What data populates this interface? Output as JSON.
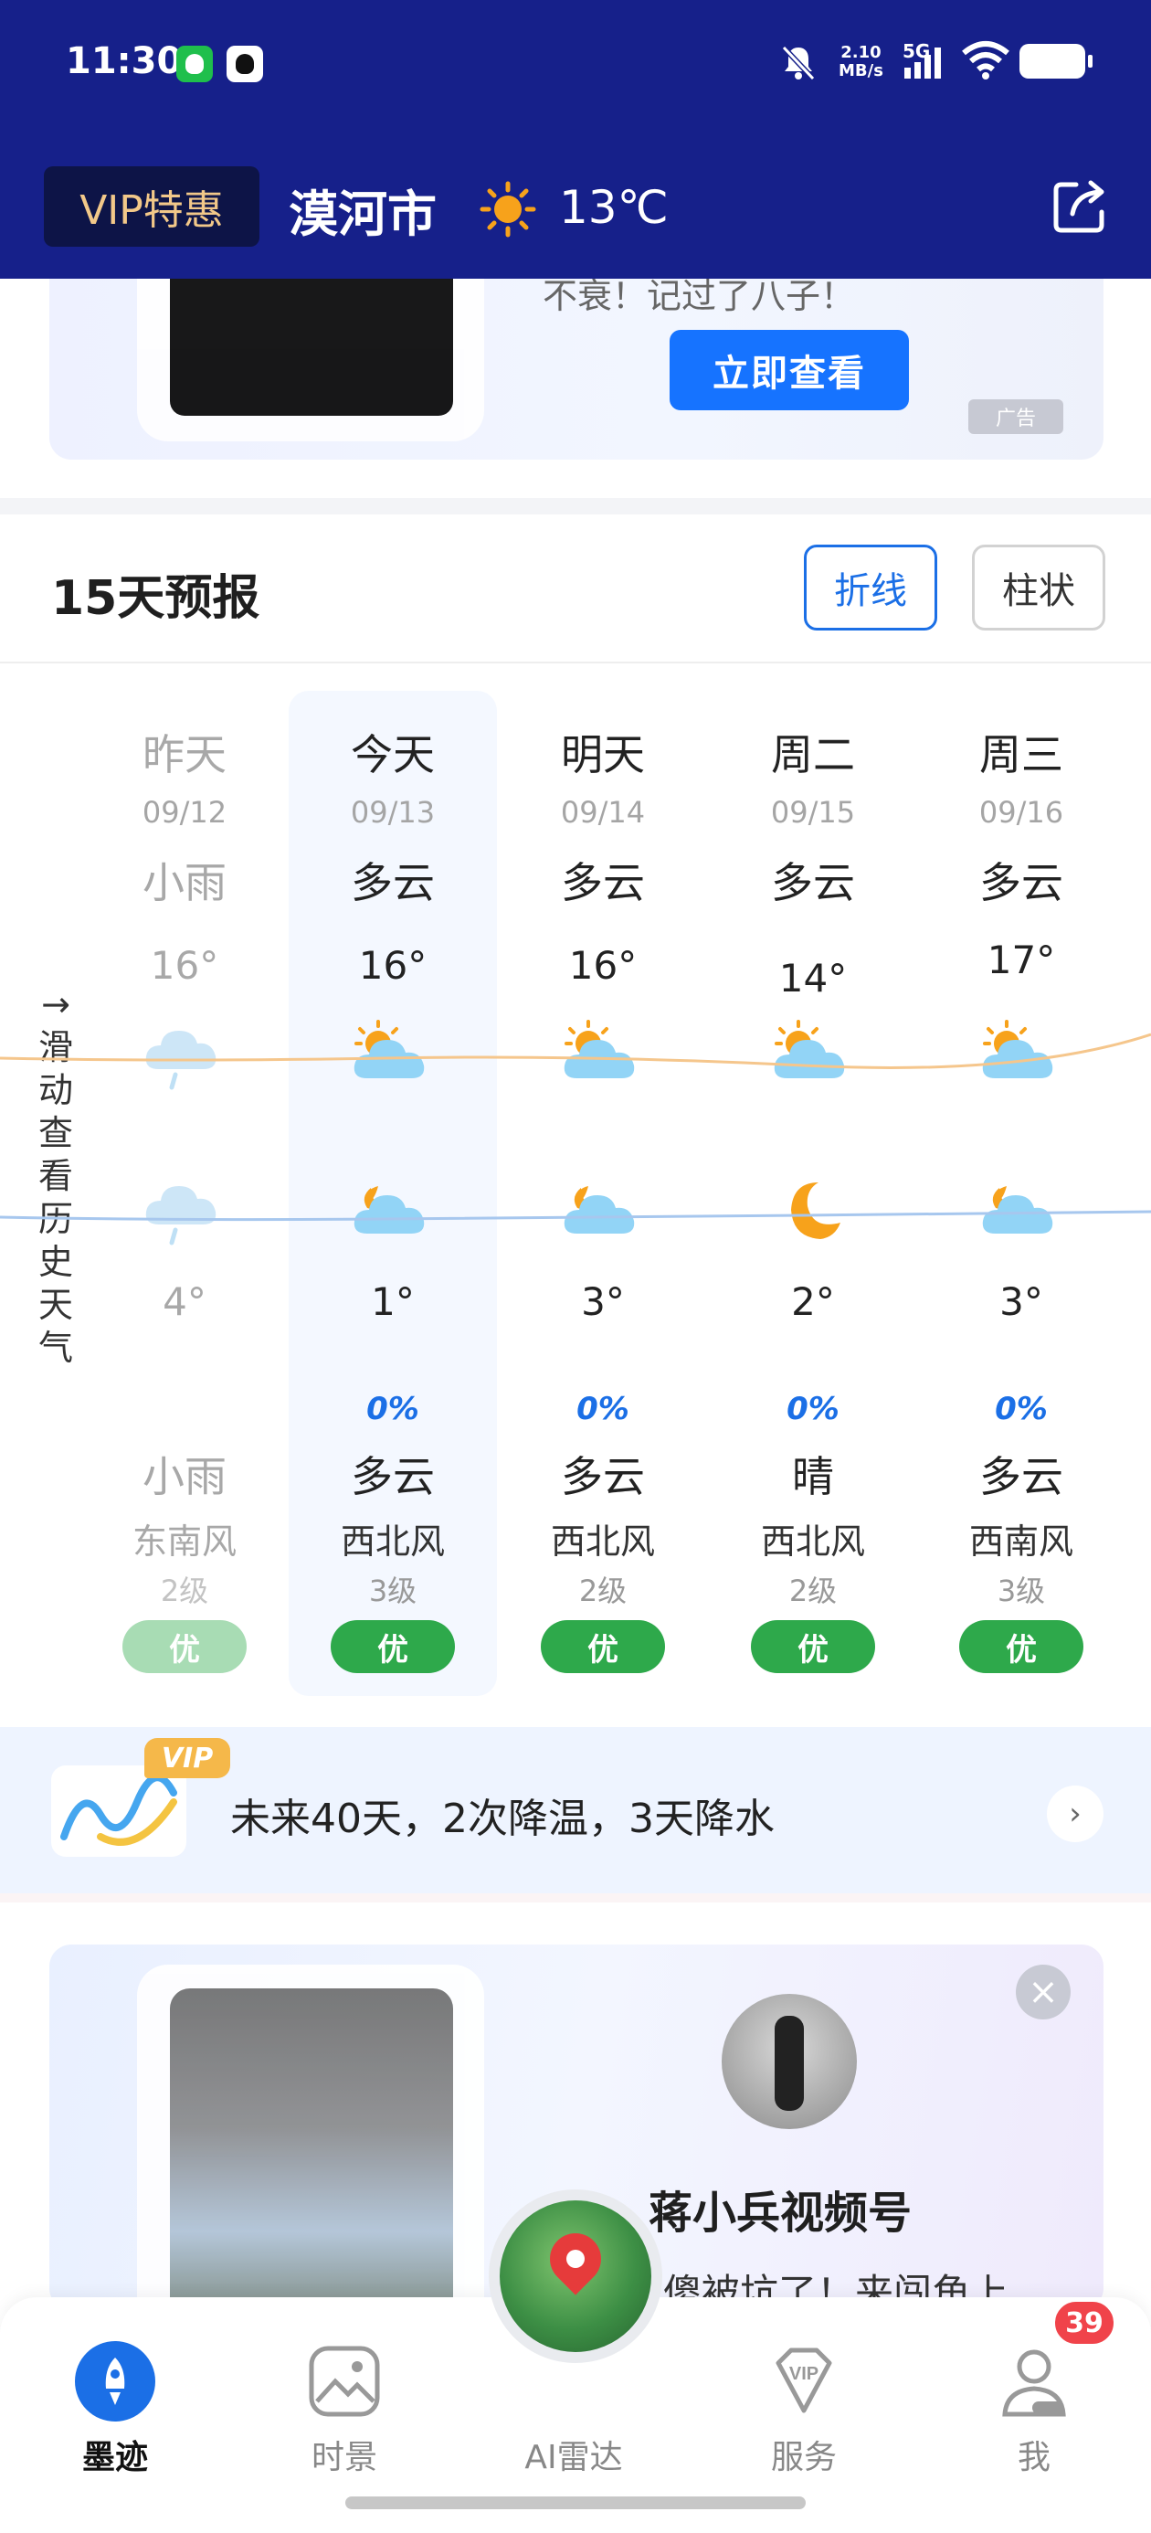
{
  "status_bar": {
    "time": "11:30",
    "net_speed_value": "2.10",
    "net_speed_unit": "MB/s",
    "signal_label": "5G",
    "icons": [
      "wechat-icon",
      "qq-icon",
      "bell-muted-icon",
      "signal-icon",
      "wifi-icon",
      "battery-icon"
    ]
  },
  "header": {
    "vip_label": "VIP特惠",
    "city": "漠河市",
    "current_temp": "13℃",
    "weather_icon": "sun-icon",
    "share_icon": "share-icon"
  },
  "ad_top": {
    "partial_text": "不衰！记过了八子！",
    "cta_label": "立即查看",
    "ad_tag": "广告"
  },
  "forecast": {
    "title": "15天预报",
    "toggle_line": "折线",
    "toggle_bar": "柱状",
    "side_hint": "→滑动查看历史天气",
    "days": [
      {
        "day": "昨天",
        "date": "09/12",
        "day_weather": "小雨",
        "high": "16°",
        "low": "4°",
        "precip": "",
        "night_weather": "小雨",
        "wind_dir": "东南风",
        "wind_level": "2级",
        "aqi": "优",
        "day_icon": "cloud-rain-icon",
        "night_icon": "cloud-rain-icon",
        "past": true
      },
      {
        "day": "今天",
        "date": "09/13",
        "day_weather": "多云",
        "high": "16°",
        "low": "1°",
        "precip": "0%",
        "night_weather": "多云",
        "wind_dir": "西北风",
        "wind_level": "3级",
        "aqi": "优",
        "day_icon": "partly-cloudy-day-icon",
        "night_icon": "partly-cloudy-night-icon",
        "past": false
      },
      {
        "day": "明天",
        "date": "09/14",
        "day_weather": "多云",
        "high": "16°",
        "low": "3°",
        "precip": "0%",
        "night_weather": "多云",
        "wind_dir": "西北风",
        "wind_level": "2级",
        "aqi": "优",
        "day_icon": "partly-cloudy-day-icon",
        "night_icon": "partly-cloudy-night-icon",
        "past": false
      },
      {
        "day": "周二",
        "date": "09/15",
        "day_weather": "多云",
        "high": "14°",
        "low": "2°",
        "precip": "0%",
        "night_weather": "晴",
        "wind_dir": "西北风",
        "wind_level": "2级",
        "aqi": "优",
        "day_icon": "partly-cloudy-day-icon",
        "night_icon": "moon-icon",
        "past": false
      },
      {
        "day": "周三",
        "date": "09/16",
        "day_weather": "多云",
        "high": "17°",
        "low": "3°",
        "precip": "0%",
        "night_weather": "多云",
        "wind_dir": "西南风",
        "wind_level": "3级",
        "aqi": "优",
        "day_icon": "partly-cloudy-day-icon",
        "night_icon": "partly-cloudy-night-icon",
        "past": false
      }
    ],
    "colors": {
      "high_line": "#f5b25a",
      "low_line": "#8cb8ea",
      "aqi_good": "#2ea94b",
      "accent": "#1b6fe6"
    }
  },
  "banner40": {
    "vip_tag": "VIP",
    "text": "未来40天，2次降温，3天降水"
  },
  "ad_bottom": {
    "name": "蒋小兵视频号",
    "sub": "傻被坑了！来闯角上"
  },
  "bottom_nav": {
    "items": [
      {
        "label": "墨迹",
        "icon": "rocket-icon",
        "active": true
      },
      {
        "label": "时景",
        "icon": "image-icon",
        "active": false
      },
      {
        "label": "AI雷达",
        "icon": "radar-globe-icon",
        "active": false
      },
      {
        "label": "服务",
        "icon": "vip-diamond-icon",
        "active": false
      },
      {
        "label": "我",
        "icon": "user-icon",
        "active": false
      }
    ],
    "badge_count": "39"
  }
}
